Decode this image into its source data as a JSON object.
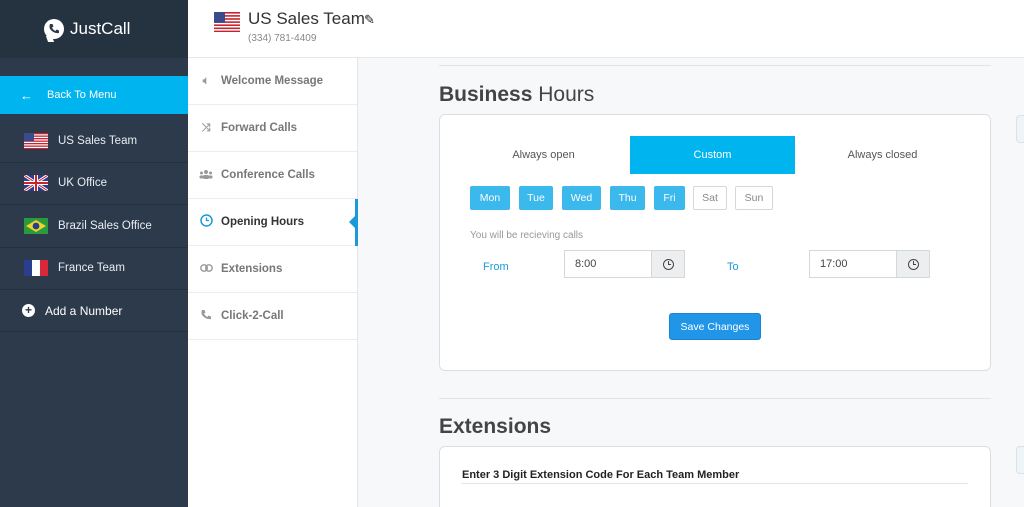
{
  "app": {
    "name": "JustCall"
  },
  "sidebar": {
    "back_label": "Back To Menu",
    "numbers": [
      {
        "label": "US Sales Team",
        "flag": "us-flag"
      },
      {
        "label": "UK Office",
        "flag": "uk-flag"
      },
      {
        "label": "Brazil Sales Office",
        "flag": "brazil-flag"
      },
      {
        "label": "France Team",
        "flag": "france-flag"
      }
    ],
    "add_label": "Add a Number"
  },
  "header": {
    "title": "US Sales Team",
    "phone": "(334) 781-4409"
  },
  "submenu": {
    "items": [
      {
        "label": "Welcome Message",
        "icon": "speaker-icon"
      },
      {
        "label": "Forward Calls",
        "icon": "shuffle-icon"
      },
      {
        "label": "Conference Calls",
        "icon": "group-icon"
      },
      {
        "label": "Opening Hours",
        "icon": "clock-icon",
        "active": true
      },
      {
        "label": "Extensions",
        "icon": "link-icon"
      },
      {
        "label": "Click-2-Call",
        "icon": "phone-icon"
      }
    ]
  },
  "business_hours": {
    "title_bold": "Business",
    "title_rest": "Hours",
    "modes": [
      "Always open",
      "Custom",
      "Always closed"
    ],
    "selected_mode": "Custom",
    "days": [
      {
        "label": "Mon",
        "on": true
      },
      {
        "label": "Tue",
        "on": true
      },
      {
        "label": "Wed",
        "on": true
      },
      {
        "label": "Thu",
        "on": true
      },
      {
        "label": "Fri",
        "on": true
      },
      {
        "label": "Sat",
        "on": false
      },
      {
        "label": "Sun",
        "on": false
      }
    ],
    "note": "You will be recieving calls",
    "from_label": "From",
    "from_value": "8:00",
    "to_label": "To",
    "to_value": "17:00",
    "save_label": "Save Changes"
  },
  "extensions": {
    "title": "Extensions",
    "subtitle": "Enter 3 Digit Extension Code For Each Team Member"
  },
  "colors": {
    "accent": "#00b4ef",
    "sidebar": "#2c3a4b",
    "save_button": "#2196e8"
  }
}
